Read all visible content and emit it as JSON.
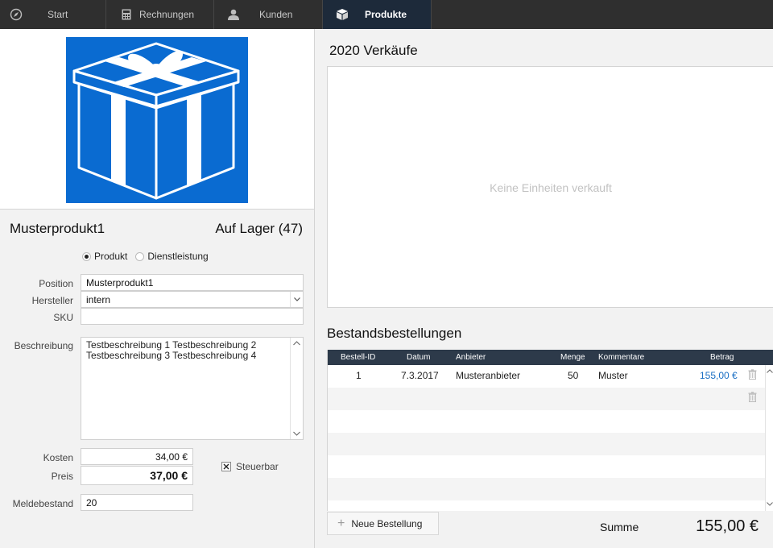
{
  "nav": {
    "tabs": [
      {
        "label": "Start",
        "icon": "compass-icon"
      },
      {
        "label": "Rechnungen",
        "icon": "calculator-icon"
      },
      {
        "label": "Kunden",
        "icon": "person-icon"
      },
      {
        "label": "Produkte",
        "icon": "box-icon",
        "active": true
      }
    ]
  },
  "product": {
    "name": "Musterprodukt1",
    "stock": "Auf Lager (47)",
    "type_options": [
      "Produkt",
      "Dienstleistung"
    ],
    "type_selected": "Produkt",
    "fields": {
      "position_label": "Position",
      "position_value": "Musterprodukt1",
      "hersteller_label": "Hersteller",
      "hersteller_value": "intern",
      "sku_label": "SKU",
      "sku_value": "",
      "beschreibung_label": "Beschreibung",
      "beschreibung_line1": "Testbeschreibung 1 Testbeschreibung 2",
      "beschreibung_line2": "Testbeschreibung 3 Testbeschreibung 4",
      "kosten_label": "Kosten",
      "kosten_value": "34,00 €",
      "preis_label": "Preis",
      "preis_value": "37,00 €",
      "steuerbar_label": "Steuerbar",
      "steuerbar_checked": true,
      "meldebestand_label": "Meldebestand",
      "meldebestand_value": "20"
    },
    "image_color": "#0a6bd1"
  },
  "sales": {
    "title": "2020 Verkäufe",
    "empty_text": "Keine Einheiten verkauft"
  },
  "orders": {
    "title": "Bestandsbestellungen",
    "columns": [
      "Bestell-ID",
      "Datum",
      "Anbieter",
      "Menge",
      "Kommentare",
      "Betrag"
    ],
    "rows": [
      {
        "id": "1",
        "datum": "7.3.2017",
        "anbieter": "Musteranbieter",
        "menge": "50",
        "kommentare": "Muster",
        "betrag": "155,00 €"
      }
    ],
    "new_button": "Neue Bestellung",
    "sum_label": "Summe",
    "sum_value": "155,00 €",
    "link_color": "#1a6fc4"
  }
}
